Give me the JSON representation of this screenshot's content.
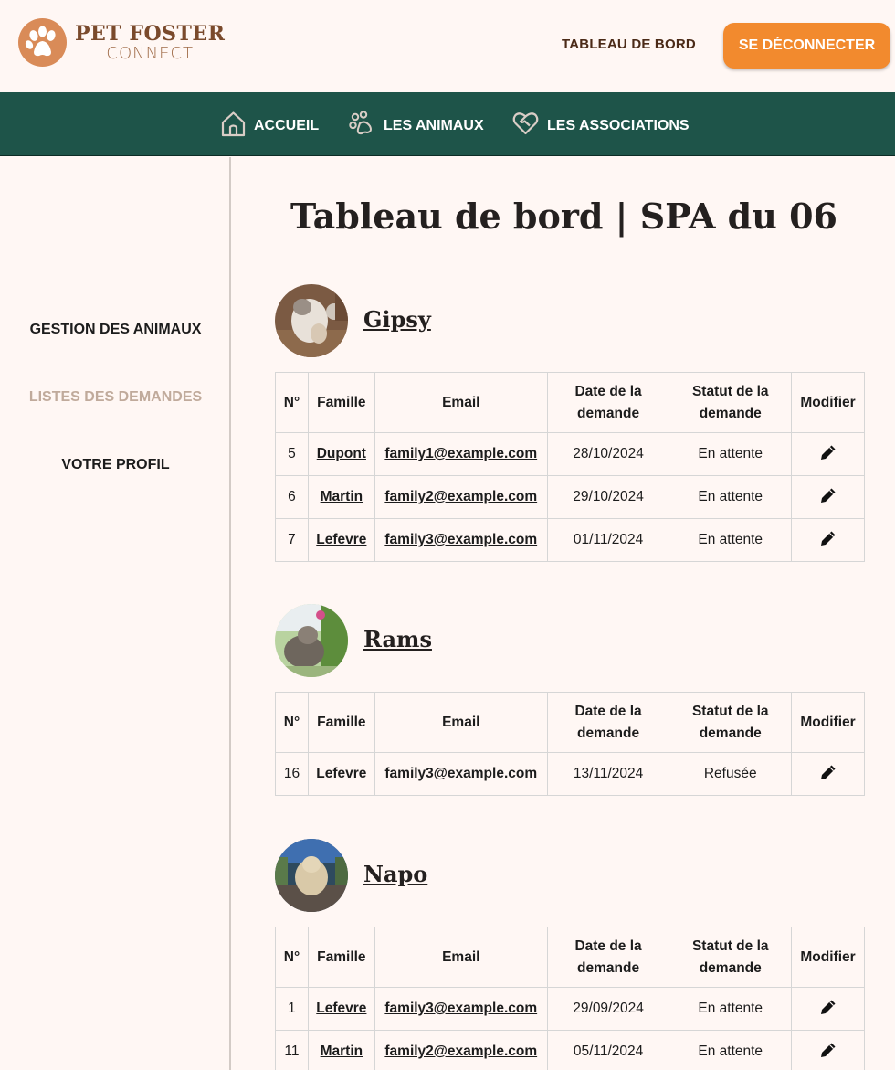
{
  "header": {
    "logo_line1": "PET FOSTER",
    "logo_line2": "CONNECT",
    "dashboard_link": "TABLEAU DE BORD",
    "logout_button": "SE DÉCONNECTER"
  },
  "nav": {
    "items": [
      {
        "label": "ACCUEIL",
        "icon": "home-icon"
      },
      {
        "label": "LES ANIMAUX",
        "icon": "paw-icon"
      },
      {
        "label": "LES ASSOCIATIONS",
        "icon": "heart-handshake-icon"
      }
    ]
  },
  "sidebar": {
    "items": [
      {
        "label": "GESTION DES ANIMAUX",
        "active": false
      },
      {
        "label": "LISTES DES DEMANDES",
        "active": true
      },
      {
        "label": "VOTRE PROFIL",
        "active": false
      }
    ]
  },
  "page": {
    "title": "Tableau de bord | SPA du 06"
  },
  "table_headers": {
    "num": "N°",
    "family": "Famille",
    "email": "Email",
    "date_line1": "Date de la",
    "date_line2": "demande",
    "status_line1": "Statut de la",
    "status_line2": "demande",
    "edit": "Modifier"
  },
  "animals": [
    {
      "name": "Gipsy",
      "rows": [
        {
          "num": "5",
          "family": "Dupont",
          "email": "family1@example.com",
          "date": "28/10/2024",
          "status": "En attente"
        },
        {
          "num": "6",
          "family": "Martin",
          "email": "family2@example.com",
          "date": "29/10/2024",
          "status": "En attente"
        },
        {
          "num": "7",
          "family": "Lefevre",
          "email": "family3@example.com",
          "date": "01/11/2024",
          "status": "En attente"
        }
      ]
    },
    {
      "name": "Rams",
      "rows": [
        {
          "num": "16",
          "family": "Lefevre",
          "email": "family3@example.com",
          "date": "13/11/2024",
          "status": "Refusée"
        }
      ]
    },
    {
      "name": "Napo",
      "rows": [
        {
          "num": "1",
          "family": "Lefevre",
          "email": "family3@example.com",
          "date": "29/09/2024",
          "status": "En attente"
        },
        {
          "num": "11",
          "family": "Martin",
          "email": "family2@example.com",
          "date": "05/11/2024",
          "status": "En attente"
        }
      ]
    }
  ],
  "colors": {
    "background": "#fff7f4",
    "nav_green": "#1e5449",
    "logout_orange": "#f28a2e",
    "logo_brown": "#7a4a2c",
    "sidebar_active": "#c0aa9b"
  }
}
